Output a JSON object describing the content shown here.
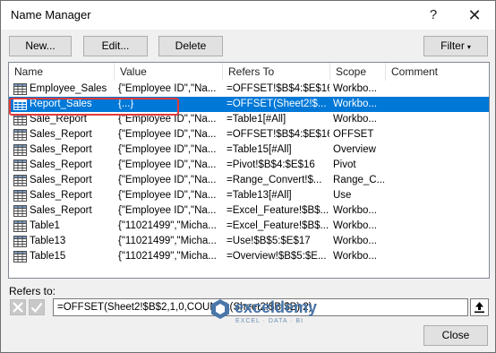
{
  "window": {
    "title": "Name Manager",
    "help_glyph": "?",
    "close_glyph": "✕"
  },
  "toolbar": {
    "new_label": "New...",
    "edit_label": "Edit...",
    "delete_label": "Delete",
    "filter_label": "Filter",
    "filter_caret": "▾"
  },
  "list": {
    "columns": [
      "Name",
      "Value",
      "Refers To",
      "Scope",
      "Comment"
    ],
    "rows": [
      {
        "name": "Employee_Sales",
        "value": "{\"Employee ID\",\"Na...",
        "refers": "=OFFSET!$B$4:$E$16",
        "scope": "Workbo...",
        "selected": false
      },
      {
        "name": "Report_Sales",
        "value": "{...}",
        "refers": "=OFFSET(Sheet2!$...",
        "scope": "Workbo...",
        "selected": true
      },
      {
        "name": "Sale_Report",
        "value": "{\"Employee ID\",\"Na...",
        "refers": "=Table1[#All]",
        "scope": "Workbo...",
        "selected": false
      },
      {
        "name": "Sales_Report",
        "value": "{\"Employee ID\",\"Na...",
        "refers": "=OFFSET!$B$4:$E$16",
        "scope": "OFFSET",
        "selected": false
      },
      {
        "name": "Sales_Report",
        "value": "{\"Employee ID\",\"Na...",
        "refers": "=Table15[#All]",
        "scope": "Overview",
        "selected": false
      },
      {
        "name": "Sales_Report",
        "value": "{\"Employee ID\",\"Na...",
        "refers": "=Pivot!$B$4:$E$16",
        "scope": "Pivot",
        "selected": false
      },
      {
        "name": "Sales_Report",
        "value": "{\"Employee ID\",\"Na...",
        "refers": "=Range_Convert!$...",
        "scope": "Range_C...",
        "selected": false
      },
      {
        "name": "Sales_Report",
        "value": "{\"Employee ID\",\"Na...",
        "refers": "=Table13[#All]",
        "scope": "Use",
        "selected": false
      },
      {
        "name": "Sales_Report",
        "value": "{\"Employee ID\",\"Na...",
        "refers": "=Excel_Feature!$B$...",
        "scope": "Workbo...",
        "selected": false
      },
      {
        "name": "Table1",
        "value": "{\"11021499\",\"Micha...",
        "refers": "=Excel_Feature!$B$...",
        "scope": "Workbo...",
        "selected": false
      },
      {
        "name": "Table13",
        "value": "{\"11021499\",\"Micha...",
        "refers": "=Use!$B$5:$E$17",
        "scope": "Workbo...",
        "selected": false
      },
      {
        "name": "Table15",
        "value": "{\"11021499\",\"Micha...",
        "refers": "=Overview!$B$5:$E...",
        "scope": "Workbo...",
        "selected": false
      }
    ]
  },
  "refers_to": {
    "label": "Refers to:",
    "formula": "=OFFSET(Sheet2!$B$2,1,0,COUNTA(Sheet2!$B:$B),2)"
  },
  "footer": {
    "close_label": "Close"
  },
  "watermark": {
    "name": "exceldemy",
    "tagline": "EXCEL · DATA · BI"
  },
  "colors": {
    "selection": "#0078d7",
    "highlight_box": "#e23a3a",
    "watermark": "#4a76a8"
  }
}
